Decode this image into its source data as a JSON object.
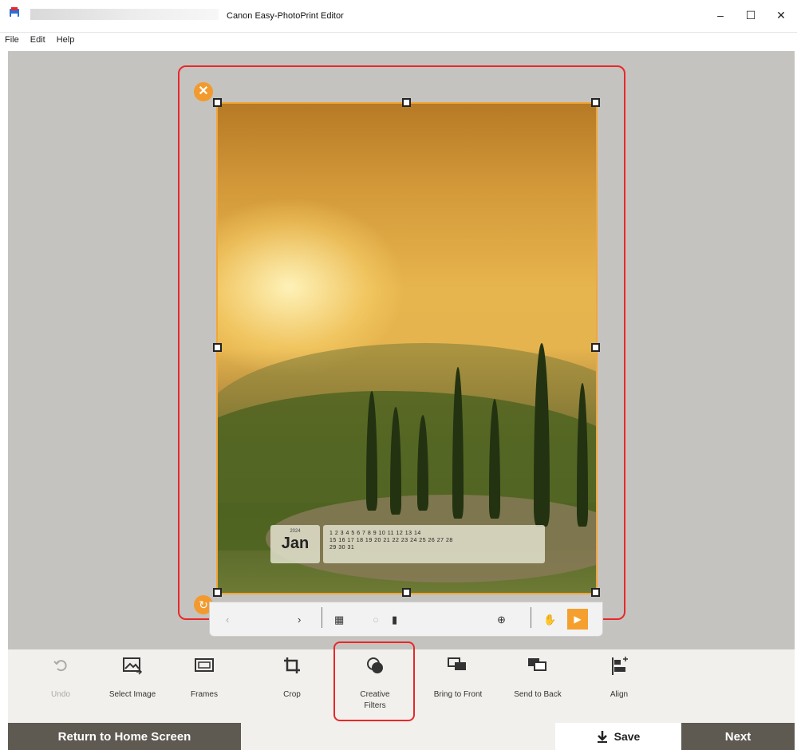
{
  "window": {
    "title": "Canon Easy-PhotoPrint Editor",
    "minimize": "–",
    "maximize": "☐",
    "close": "✕"
  },
  "menu": [
    "File",
    "Edit",
    "Help"
  ],
  "calendar": {
    "year": "2024",
    "month": "Jan",
    "rows": [
      "1  2  3  4  5  6  7  8  9 10 11 12 13 14",
      "15 16 17 18 19 20 21 22 23 24 25 26 27 28",
      "29 30 31"
    ]
  },
  "toolbar": {
    "undo": "Undo",
    "select_image": "Select Image",
    "frames": "Frames",
    "crop": "Crop",
    "creative_filters_line1": "Creative",
    "creative_filters_line2": "Filters",
    "bring_to_front": "Bring to Front",
    "send_to_back": "Send to Back",
    "align": "Align"
  },
  "footer": {
    "return_home": "Return to Home Screen",
    "save": "Save",
    "next": "Next"
  },
  "colors": {
    "highlight": "#e8282a",
    "accent": "#f29a2e",
    "footer_dark": "#5e5a52"
  }
}
